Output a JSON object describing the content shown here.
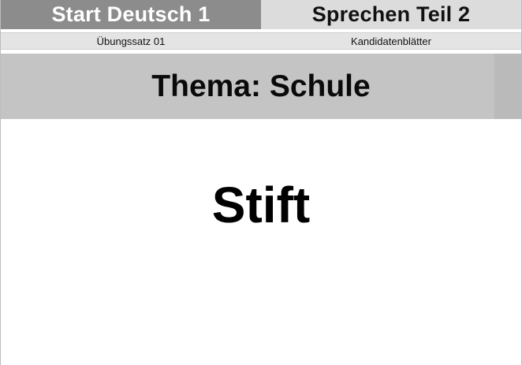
{
  "header": {
    "exam_title": "Start Deutsch 1",
    "section_title": "Sprechen Teil 2"
  },
  "subheader": {
    "set_label": "Übungssatz 01",
    "sheet_label": "Kandidatenblätter"
  },
  "theme": {
    "title": "Thema: Schule"
  },
  "card": {
    "word": "Stift"
  },
  "colors": {
    "header_left_bg": "#8c8c8c",
    "header_right_bg": "#dcdcdc",
    "subheader_bg": "#e4e4e4",
    "theme_band_bg": "#c4c4c4",
    "page_bg": "#ffffff",
    "text": "#000000"
  }
}
